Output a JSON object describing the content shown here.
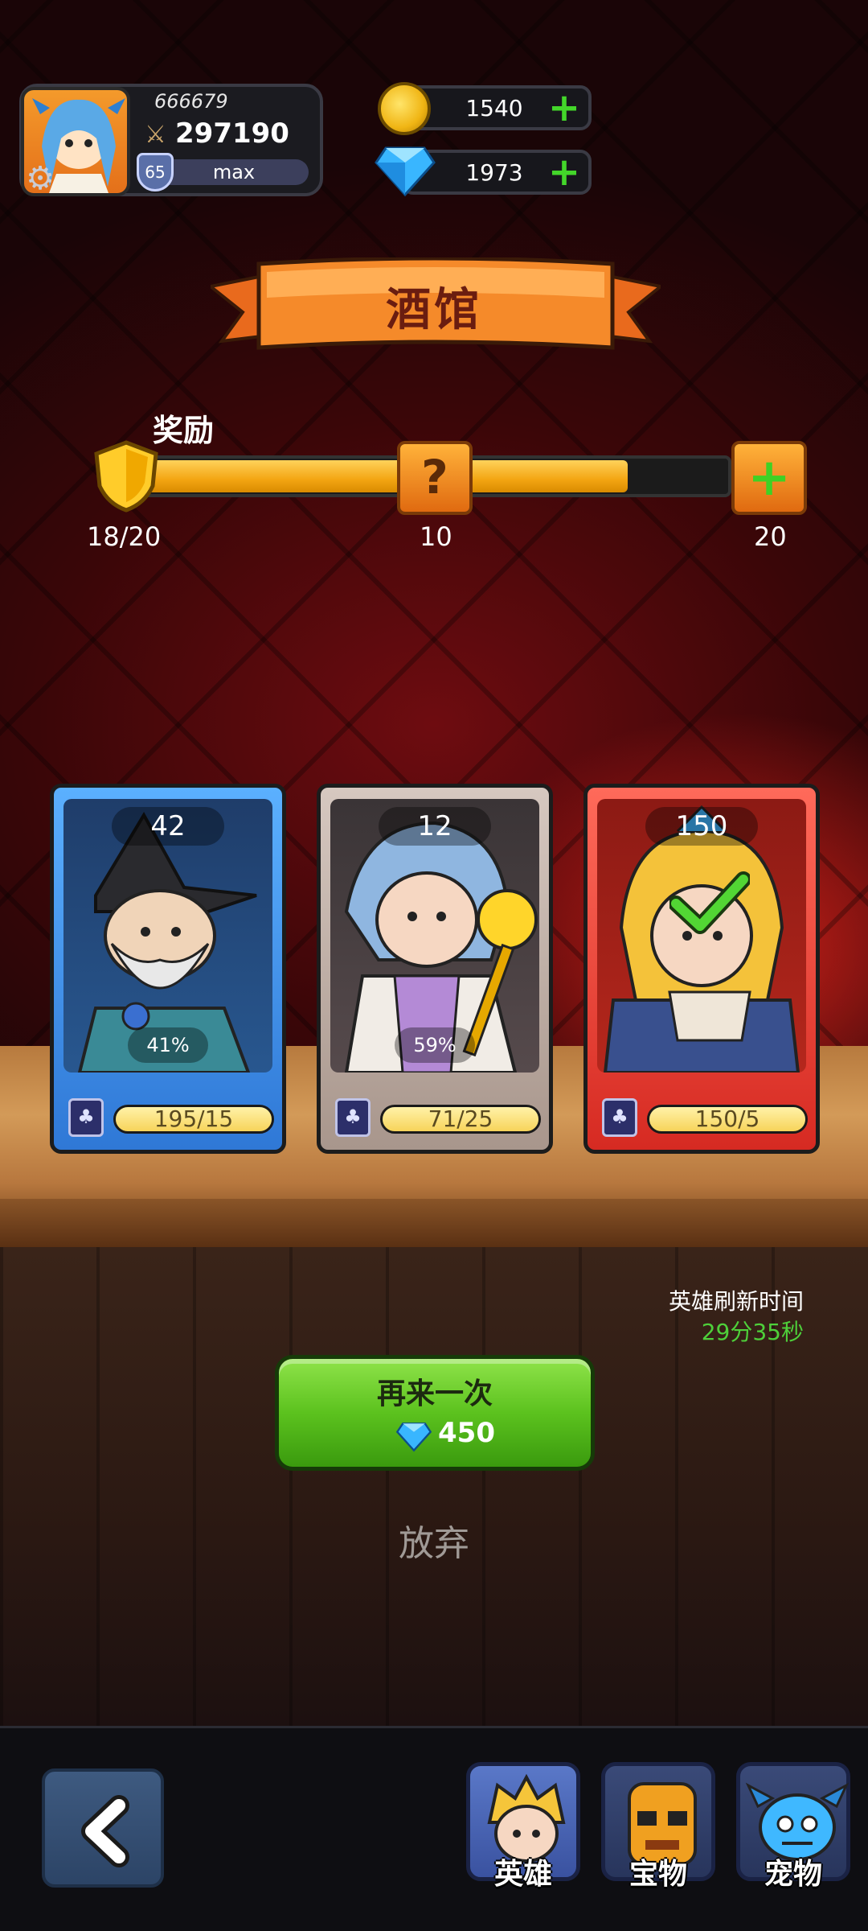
{
  "player": {
    "id": "666679",
    "power": "297190",
    "level": "65",
    "level_status": "max"
  },
  "currency": {
    "coins": "1540",
    "gems": "1973"
  },
  "banner": {
    "title": "酒馆"
  },
  "reward": {
    "label": "奖励",
    "progress": 0.9,
    "current": "18/20",
    "milestone_mid": "10",
    "milestone_end": "20"
  },
  "cards": [
    {
      "count": "42",
      "percent": "41%",
      "fragments": "195/15",
      "hero": "wizard",
      "frame": "blue"
    },
    {
      "count": "12",
      "percent": "59%",
      "fragments": "71/25",
      "hero": "priestess",
      "frame": "grey"
    },
    {
      "count": "150",
      "percent": "",
      "fragments": "150/5",
      "hero": "knight",
      "frame": "red",
      "selected": true
    }
  ],
  "refresh": {
    "label": "英雄刷新时间",
    "time": "29分35秒"
  },
  "actions": {
    "again_label": "再来一次",
    "again_cost": "450",
    "giveup_label": "放弃"
  },
  "nav": {
    "heroes": "英雄",
    "treasures": "宝物",
    "pets": "宠物"
  },
  "icons": [
    "gear-icon",
    "sword-icon",
    "coin-icon",
    "gem-icon",
    "plus-icon",
    "shield-icon",
    "mystery-icon",
    "deck-icon",
    "check-icon",
    "back-arrow-icon"
  ],
  "colors": {
    "accent_green": "#4ed03a",
    "frame_blue": "#3d8fe0",
    "frame_grey": "#b8aaa2",
    "frame_red": "#e5322a"
  }
}
